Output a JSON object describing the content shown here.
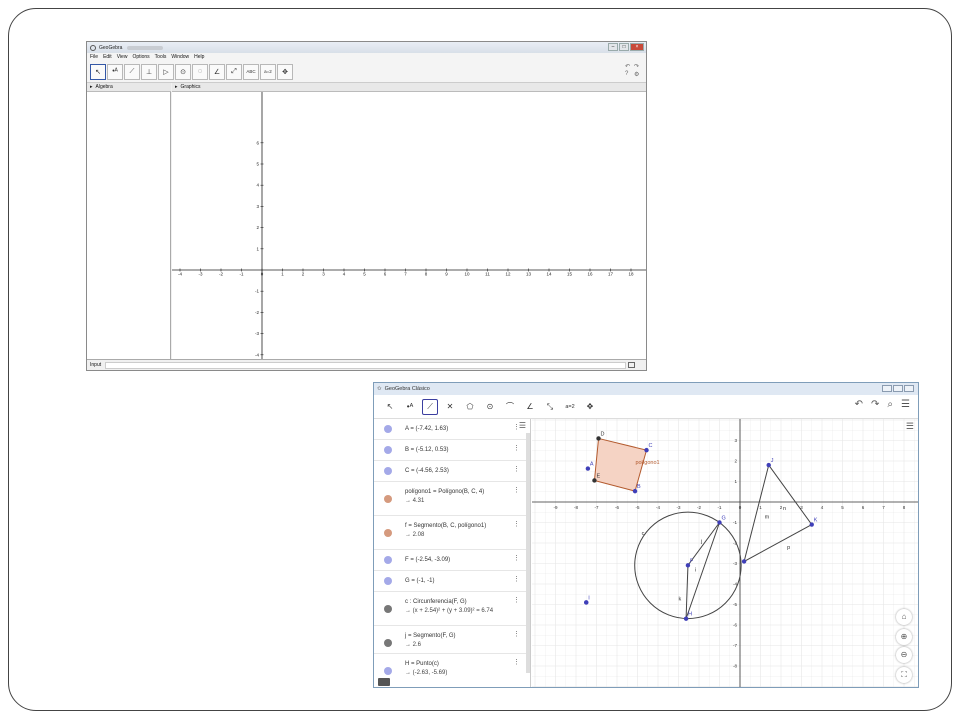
{
  "window1": {
    "title": "GeoGebra",
    "menu": [
      "File",
      "Edit",
      "View",
      "Options",
      "Tools",
      "Window",
      "Help"
    ],
    "toolbar": [
      {
        "icon": "move-arrow-icon",
        "glyph": "↖",
        "active": true
      },
      {
        "icon": "point-icon",
        "glyph": "•ᴬ"
      },
      {
        "icon": "line-icon",
        "glyph": "⟋"
      },
      {
        "icon": "perpendicular-line-icon",
        "glyph": "⊥"
      },
      {
        "icon": "polygon-icon",
        "glyph": "▷"
      },
      {
        "icon": "circle-icon",
        "glyph": "⊙"
      },
      {
        "icon": "ellipse-icon",
        "glyph": "◌"
      },
      {
        "icon": "angle-icon",
        "glyph": "∠"
      },
      {
        "icon": "reflect-icon",
        "glyph": "⤢"
      },
      {
        "icon": "text-icon",
        "glyph": "ABC"
      },
      {
        "icon": "slider-icon",
        "glyph": "a=2"
      },
      {
        "icon": "move-view-icon",
        "glyph": "✥"
      }
    ],
    "algebra_label": "Algebra",
    "graphics_label": "Graphics",
    "input_label": "Input",
    "x_ticks": [
      "-4",
      "-3",
      "-2",
      "-1",
      "0",
      "1",
      "2",
      "3",
      "4",
      "5",
      "6",
      "7",
      "8",
      "9",
      "10",
      "11",
      "12",
      "13",
      "14",
      "15",
      "16",
      "17",
      "18"
    ],
    "y_ticks": [
      "6",
      "5",
      "4",
      "3",
      "2",
      "1",
      "-1",
      "-2",
      "-3",
      "-4",
      "-5",
      "-6"
    ]
  },
  "window2": {
    "title": "GeoGebra Clásico",
    "toolbar": [
      {
        "icon": "move-arrow-icon",
        "glyph": "↖"
      },
      {
        "icon": "point-icon",
        "glyph": "•ᴬ"
      },
      {
        "icon": "segment-icon",
        "glyph": "⟋",
        "active": true
      },
      {
        "icon": "perpendicular-line-icon",
        "glyph": "✕"
      },
      {
        "icon": "polygon-icon",
        "glyph": "⬠"
      },
      {
        "icon": "circle-icon",
        "glyph": "⊙"
      },
      {
        "icon": "conic-icon",
        "glyph": "⌒"
      },
      {
        "icon": "angle-icon",
        "glyph": "∠"
      },
      {
        "icon": "reflect-icon",
        "glyph": "⤡"
      },
      {
        "icon": "slider-icon",
        "glyph": "a=2"
      },
      {
        "icon": "move-view-icon",
        "glyph": "✥"
      }
    ],
    "algebra_rows": [
      {
        "line1": "A = (-7.42, 1.63)",
        "line2": "",
        "color": "#a4a9e8"
      },
      {
        "line1": "B = (-5.12, 0.53)",
        "line2": "",
        "color": "#a4a9e8"
      },
      {
        "line1": "C = (-4.56, 2.53)",
        "line2": "",
        "color": "#a4a9e8"
      },
      {
        "line1": "polígono1 = Polígono(B, C, 4)",
        "line2": "→  4.31",
        "color": "#d59a7e"
      },
      {
        "line1": "f = Segmento(B, C, polígono1)",
        "line2": "→  2.08",
        "color": "#d59a7e"
      },
      {
        "line1": "F = (-2.54, -3.09)",
        "line2": "",
        "color": "#a4a9e8"
      },
      {
        "line1": "G = (-1, -1)",
        "line2": "",
        "color": "#a4a9e8"
      },
      {
        "line1": "c : Circunferencia(F, G)",
        "line2": "→  (x + 2.54)² + (y + 3.09)² = 6.74",
        "color": "#777777"
      },
      {
        "line1": "j = Segmento(F, G)",
        "line2": "→  2.6",
        "color": "#777777"
      },
      {
        "line1": "H = Punto(c)",
        "line2": "→  (-2.63, -5.69)",
        "color": "#a4a9e8"
      }
    ],
    "x_ticks": [
      "-9",
      "-8",
      "-7",
      "-6",
      "-5",
      "-4",
      "-3",
      "-2",
      "-1",
      "0",
      "1",
      "2",
      "3",
      "4",
      "5",
      "6",
      "7",
      "8",
      "9"
    ],
    "y_ticks": [
      "3",
      "2",
      "1",
      "-1",
      "-2",
      "-3",
      "-4",
      "-5",
      "-6",
      "-7",
      "-8"
    ],
    "points": [
      {
        "name": "A",
        "x": -7.42,
        "y": 1.63
      },
      {
        "name": "B",
        "x": -5.12,
        "y": 0.53
      },
      {
        "name": "C",
        "x": -4.56,
        "y": 2.53
      },
      {
        "name": "D",
        "x": -6.9,
        "y": 3.1
      },
      {
        "name": "E",
        "x": -7.1,
        "y": 1.05
      },
      {
        "name": "F",
        "x": -2.54,
        "y": -3.09
      },
      {
        "name": "G",
        "x": -1,
        "y": -1
      },
      {
        "name": "H",
        "x": -2.63,
        "y": -5.69
      },
      {
        "name": "I",
        "x": -7.5,
        "y": -4.9
      },
      {
        "name": "J",
        "x": 1.4,
        "y": 1.8
      },
      {
        "name": "K",
        "x": 3.5,
        "y": -1.1
      },
      {
        "name": "L",
        "x": 0.8,
        "y": -2.9
      }
    ],
    "polygon_label": "polígono1",
    "line_labels": {
      "c": "c",
      "j": "j",
      "k": "k",
      "i": "i",
      "m": "m",
      "n": "n",
      "p": "p"
    },
    "colors": {
      "polygon_fill": "#f5d3c4",
      "polygon_stroke": "#b35a2e",
      "point": "#3f3fb8",
      "grid": "#e6e6e6"
    }
  }
}
